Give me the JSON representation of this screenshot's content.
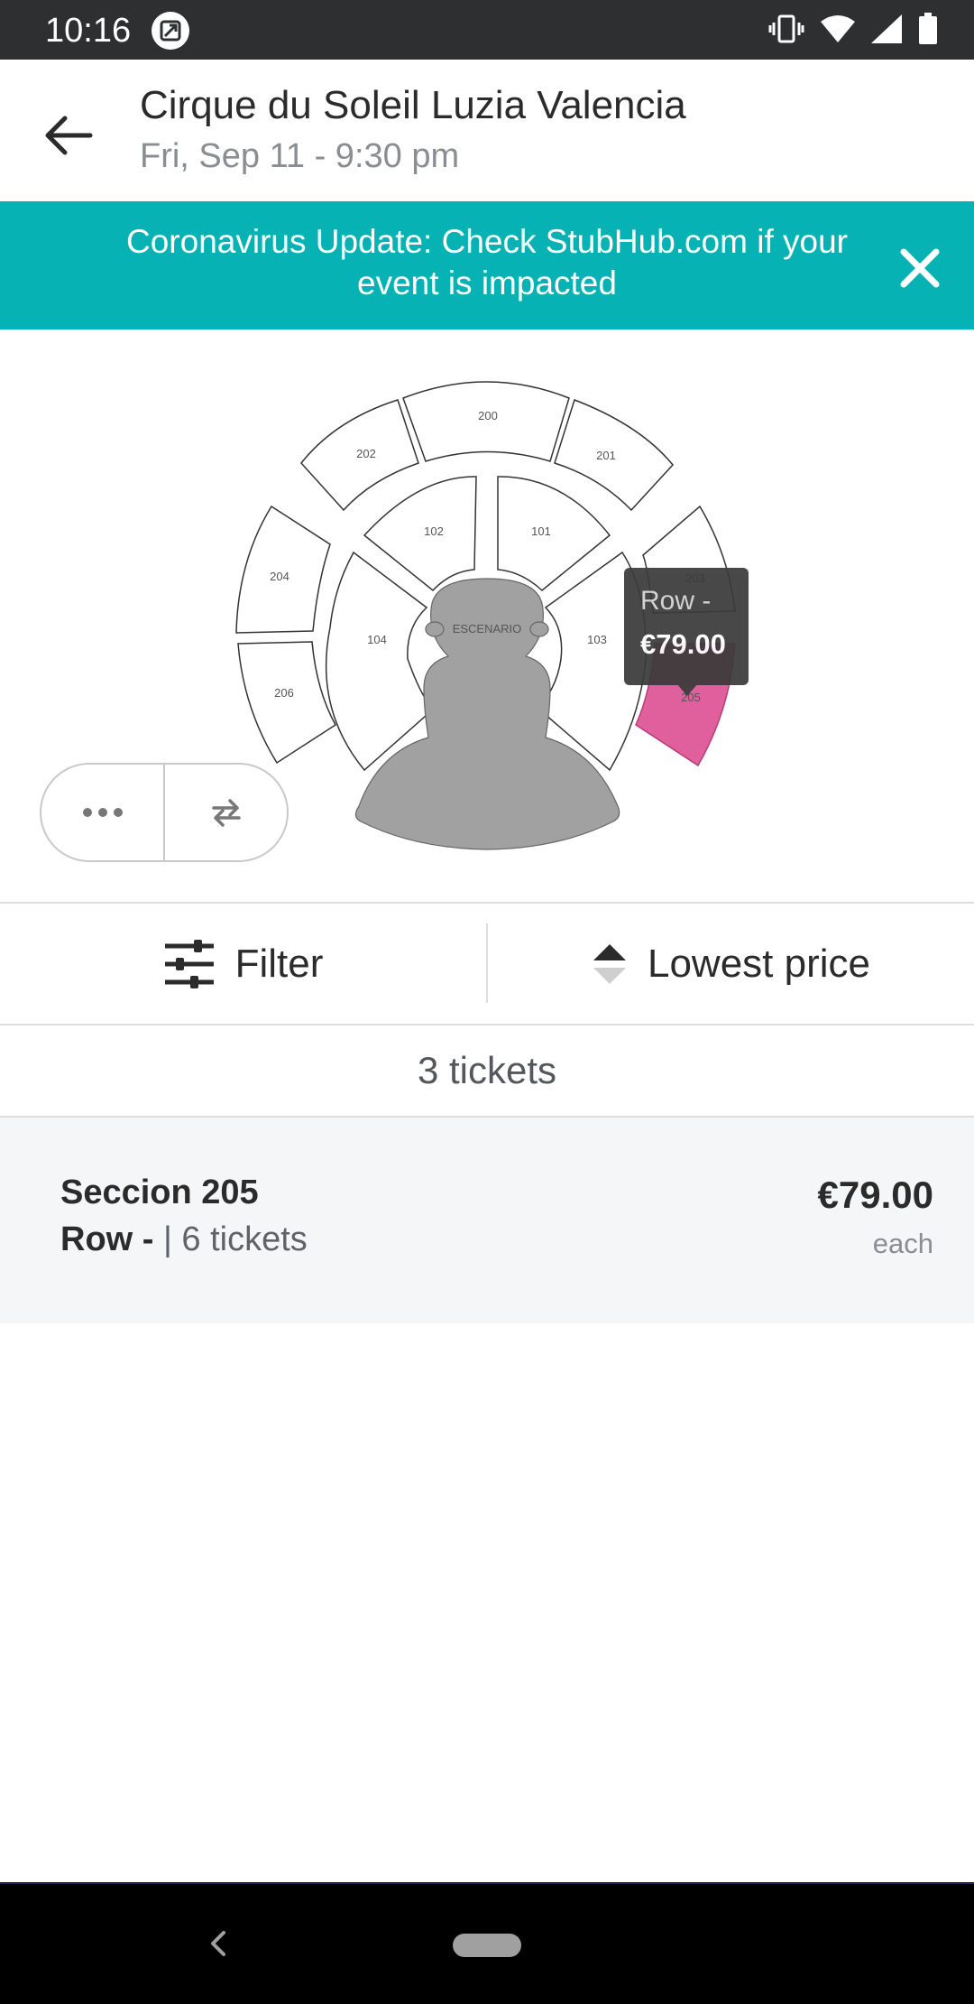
{
  "status_bar": {
    "time": "10:16",
    "icons": [
      "screenshot-icon",
      "vibrate-icon",
      "wifi-icon",
      "signal-icon",
      "battery-icon"
    ]
  },
  "header": {
    "title": "Cirque du Soleil Luzia Valencia",
    "date": "Fri, Sep 11 - 9:30 pm",
    "back_icon": "arrow-left-icon"
  },
  "banner": {
    "text": "Coronavirus Update: Check StubHub.com if your event is impacted",
    "close_icon": "close-icon",
    "color": "#06b2b3"
  },
  "seat_map": {
    "stage_label": "ESCENARIO",
    "sections": {
      "s200": "200",
      "s201": "201",
      "s202": "202",
      "s203": "203",
      "s204": "204",
      "s205": "205",
      "s206": "206",
      "s101": "101",
      "s102": "102",
      "s103": "103",
      "s104": "104"
    },
    "highlighted_section": "205",
    "highlight_color": "#e0609e",
    "tooltip": {
      "row": "Row -",
      "price": "€79.00"
    },
    "controls": {
      "more_icon": "more-horizontal-icon",
      "swap_icon": "swap-arrows-icon"
    }
  },
  "toolbar": {
    "filter_label": "Filter",
    "filter_icon": "sliders-icon",
    "sort_label": "Lowest price",
    "sort_icon": "sort-icon"
  },
  "results": {
    "count_label": "3 tickets"
  },
  "listings": [
    {
      "section": "Seccion 205",
      "row": "Row -",
      "quantity": "| 6 tickets",
      "price": "€79.00",
      "price_unit": "each"
    }
  ],
  "nav_bar": {
    "back_icon": "nav-back-icon",
    "home_icon": "home-pill-icon"
  }
}
